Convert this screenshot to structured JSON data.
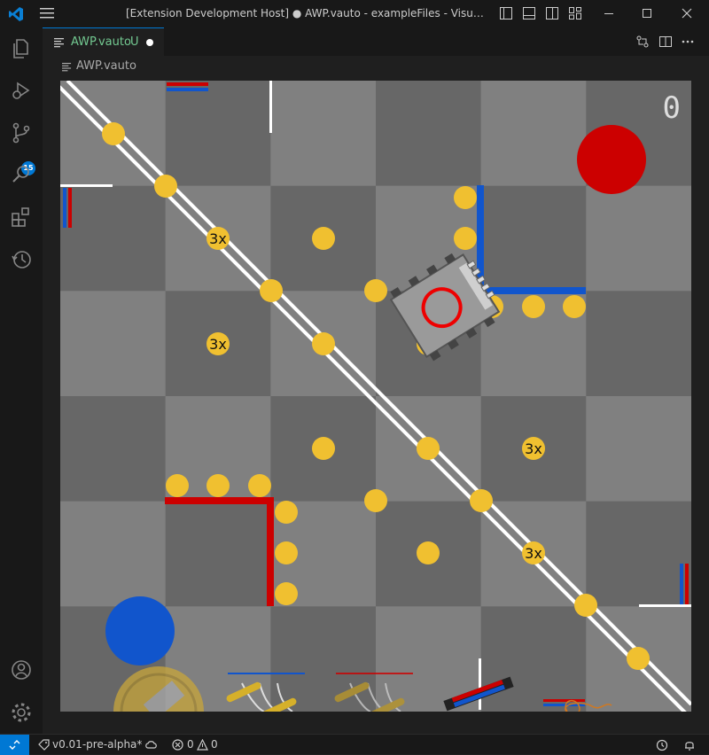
{
  "window": {
    "title": "[Extension Development Host] ● AWP.vauto - exampleFiles - Visual Studio ...",
    "controls": [
      "minimize",
      "maximize",
      "close"
    ]
  },
  "activity_bar": {
    "items": [
      "explorer-icon",
      "run-debug-icon",
      "source-control-icon",
      "search-icon",
      "extensions-icon",
      "timeline-icon"
    ],
    "source_control_badge": "15",
    "bottom": [
      "account-icon",
      "settings-gear-icon"
    ]
  },
  "editor": {
    "tab": {
      "label": "AWP.vauto",
      "status": "U"
    },
    "breadcrumb": "AWP.vauto"
  },
  "field": {
    "score": "0",
    "multiplier_label": "3x",
    "colors": {
      "light_tile": "#808080",
      "dark_tile": "#676767",
      "ring": "#f0c030",
      "red": "#cc0000",
      "blue": "#1155cc"
    }
  },
  "status_bar": {
    "version": "v0.01-pre-alpha*",
    "errors": "0",
    "warnings": "0"
  }
}
